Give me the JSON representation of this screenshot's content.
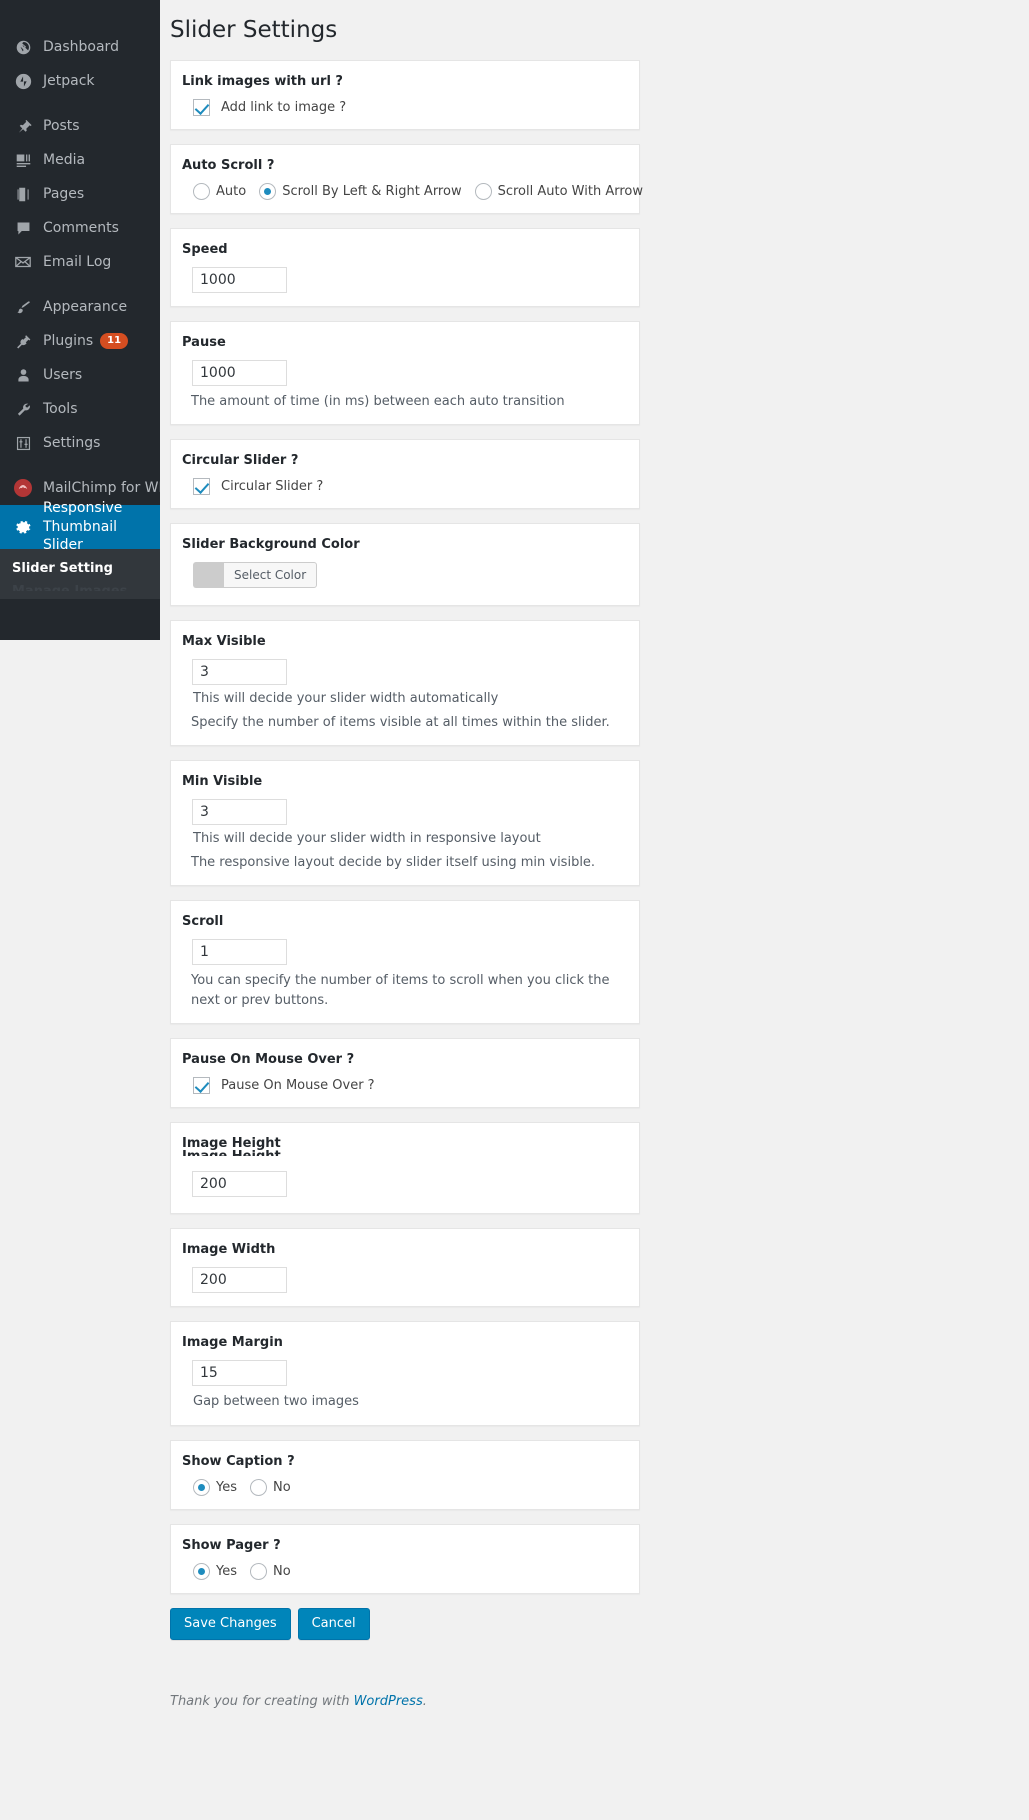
{
  "sidebar": {
    "items": [
      {
        "label": "Dashboard",
        "icon": "dashboard-icon",
        "name": "sidebar-item-dashboard"
      },
      {
        "label": "Jetpack",
        "icon": "jetpack-icon",
        "name": "sidebar-item-jetpack"
      },
      {
        "label": "Posts",
        "icon": "pin-icon",
        "name": "sidebar-item-posts"
      },
      {
        "label": "Media",
        "icon": "media-icon",
        "name": "sidebar-item-media"
      },
      {
        "label": "Pages",
        "icon": "pages-icon",
        "name": "sidebar-item-pages"
      },
      {
        "label": "Comments",
        "icon": "comment-icon",
        "name": "sidebar-item-comments"
      },
      {
        "label": "Email Log",
        "icon": "envelope-icon",
        "name": "sidebar-item-email-log"
      },
      {
        "label": "Appearance",
        "icon": "brush-icon",
        "name": "sidebar-item-appearance"
      },
      {
        "label": "Plugins",
        "icon": "plug-icon",
        "name": "sidebar-item-plugins",
        "badge": "11"
      },
      {
        "label": "Users",
        "icon": "user-icon",
        "name": "sidebar-item-users"
      },
      {
        "label": "Tools",
        "icon": "wrench-icon",
        "name": "sidebar-item-tools"
      },
      {
        "label": "Settings",
        "icon": "sliders-icon",
        "name": "sidebar-item-settings"
      },
      {
        "label": "MailChimp for WP",
        "icon": "mailchimp-icon",
        "name": "sidebar-item-mailchimp"
      }
    ],
    "current": {
      "label": "Responsive Thumbnail Slider",
      "icon": "gear-icon"
    },
    "submenu": [
      {
        "label": "Slider Setting",
        "active": true
      },
      {
        "label": "Manage Images",
        "active": false
      }
    ]
  },
  "page": {
    "title": "Slider Settings"
  },
  "sections": {
    "link_images": {
      "label": "Link images with url ?",
      "checkbox_label": "Add link to image ?",
      "checked": true
    },
    "auto_scroll": {
      "label": "Auto Scroll ?",
      "options": [
        "Auto",
        "Scroll By Left & Right Arrow",
        "Scroll Auto With Arrow"
      ],
      "selected": 1
    },
    "speed": {
      "label": "Speed",
      "value": "1000"
    },
    "pause": {
      "label": "Pause",
      "value": "1000",
      "help": "The amount of time (in ms) between each auto transition"
    },
    "circular_slider": {
      "label": "Circular Slider ?",
      "checkbox_label": "Circular Slider ?",
      "checked": true
    },
    "background_color": {
      "label": "Slider Background Color",
      "button_label": "Select Color",
      "swatch_color": "#cccccc"
    },
    "max_visible": {
      "label": "Max Visible",
      "value": "3",
      "help1": "This will decide your slider width automatically",
      "help2": "Specify the number of items visible at all times within the slider."
    },
    "min_visible": {
      "label": "Min Visible",
      "value": "3",
      "help1": "This will decide your slider width in responsive layout",
      "help2": "The responsive layout decide by slider itself using min visible."
    },
    "scroll": {
      "label": "Scroll",
      "value": "1",
      "help": "You can specify the number of items to scroll when you click the next or prev buttons."
    },
    "pause_on_mouse_over": {
      "label": "Pause On Mouse Over ?",
      "checkbox_label": "Pause On Mouse Over ?",
      "checked": true
    },
    "image_height": {
      "label": "Image Height",
      "label_dup": "Image Height",
      "value": "200"
    },
    "image_width": {
      "label": "Image Width",
      "value": "200"
    },
    "image_margin": {
      "label": "Image Margin",
      "value": "15",
      "help": "Gap between two images"
    },
    "show_caption": {
      "label": "Show Caption ?",
      "options": [
        "Yes",
        "No"
      ],
      "selected": 0
    },
    "show_pager": {
      "label": "Show Pager ?",
      "options": [
        "Yes",
        "No"
      ],
      "selected": 0
    }
  },
  "actions": {
    "save_label": "Save Changes",
    "cancel_label": "Cancel"
  },
  "footer": {
    "text_before": "Thank you for creating with ",
    "link": "WordPress",
    "text_after": "."
  },
  "colors": {
    "accent": "#0085ba",
    "sidebar_bg": "#23282d",
    "current_bg": "#0073aa",
    "badge": "#d54e21"
  }
}
